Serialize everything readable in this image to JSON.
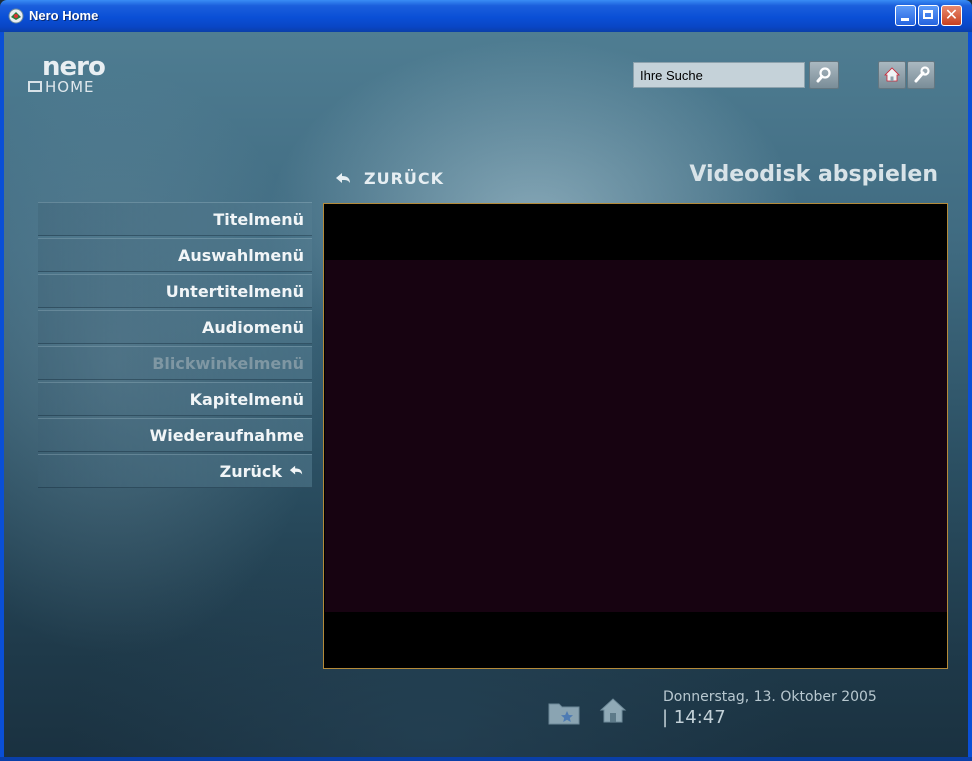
{
  "window": {
    "title": "Nero Home",
    "close_glyph": "✕"
  },
  "logo": {
    "top": "nero",
    "bottom": "HOME"
  },
  "search": {
    "value": "Ihre Suche"
  },
  "nav": {
    "back_label": "ZURÜCK",
    "page_title": "Videodisk abspielen"
  },
  "menu": {
    "items": [
      {
        "label": "Titelmenü",
        "enabled": true
      },
      {
        "label": "Auswahlmenü",
        "enabled": true
      },
      {
        "label": "Untertitelmenü",
        "enabled": true
      },
      {
        "label": "Audiomenü",
        "enabled": true
      },
      {
        "label": "Blickwinkelmenü",
        "enabled": false
      },
      {
        "label": "Kapitelmenü",
        "enabled": true
      },
      {
        "label": "Wiederaufnahme",
        "enabled": true
      },
      {
        "label": "Zurück",
        "enabled": true,
        "icon": "back-arrow-icon"
      }
    ]
  },
  "status": {
    "date": "Donnerstag, 13. Oktober 2005",
    "time": "| 14:47"
  },
  "colors": {
    "titlebar": "#0a4fd6",
    "video_border": "#b48a3a",
    "video_bg": "#170311"
  }
}
